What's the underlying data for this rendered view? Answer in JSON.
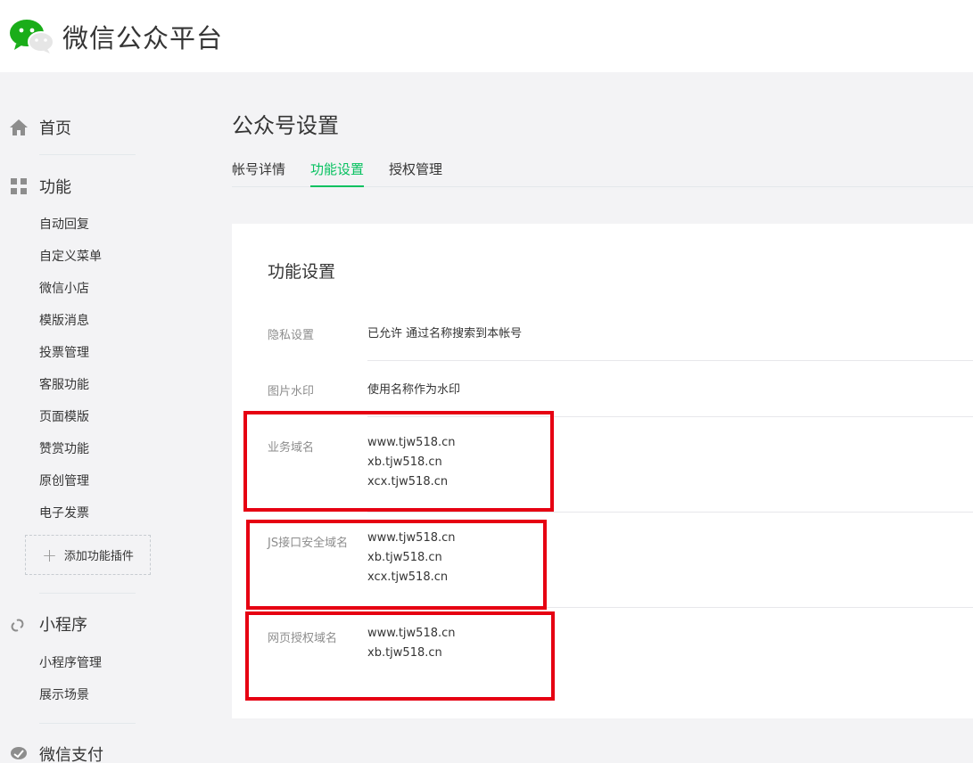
{
  "app": {
    "title": "微信公众平台"
  },
  "sidebar": {
    "home": "首页",
    "features": {
      "label": "功能",
      "items": [
        "自动回复",
        "自定义菜单",
        "微信小店",
        "模版消息",
        "投票管理",
        "客服功能",
        "页面模版",
        "赞赏功能",
        "原创管理",
        "电子发票"
      ],
      "add_plugin": "添加功能插件"
    },
    "miniprogram": {
      "label": "小程序",
      "items": [
        "小程序管理",
        "展示场景"
      ]
    },
    "wechat_pay": "微信支付"
  },
  "page": {
    "title": "公众号设置",
    "tabs": [
      "帐号详情",
      "功能设置",
      "授权管理"
    ],
    "active_tab": "功能设置"
  },
  "card": {
    "title": "功能设置",
    "rows": [
      {
        "label": "隐私设置",
        "values": [
          "已允许 通过名称搜索到本帐号"
        ]
      },
      {
        "label": "图片水印",
        "values": [
          "使用名称作为水印"
        ]
      },
      {
        "label": "业务域名",
        "values": [
          "www.tjw518.cn",
          "xb.tjw518.cn",
          "xcx.tjw518.cn"
        ]
      },
      {
        "label": "JS接口安全域名",
        "values": [
          "www.tjw518.cn",
          "xb.tjw518.cn",
          "xcx.tjw518.cn"
        ]
      },
      {
        "label": "网页授权域名",
        "values": [
          "www.tjw518.cn",
          "xb.tjw518.cn"
        ]
      }
    ]
  },
  "colors": {
    "accent": "#07c160",
    "highlight": "#e60012"
  }
}
